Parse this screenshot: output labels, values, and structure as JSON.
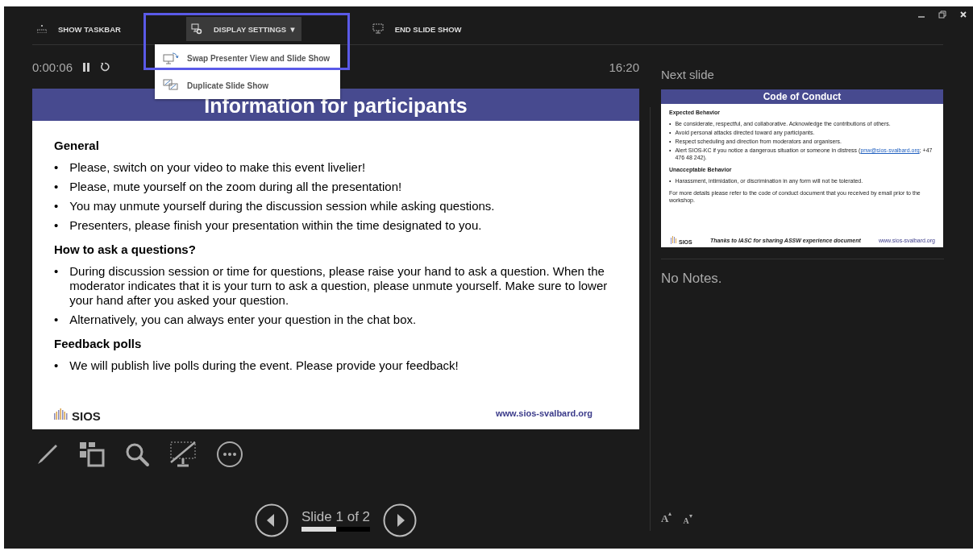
{
  "toolbar": {
    "items": [
      {
        "kind": "taskbar",
        "label": "SHOW TASKBAR",
        "expanded": false
      },
      {
        "kind": "display",
        "label": "DISPLAY SETTINGS",
        "caret": "▼",
        "expanded": true
      },
      {
        "kind": "end",
        "label": "END SLIDE SHOW",
        "expanded": false
      }
    ]
  },
  "menu": {
    "items": [
      {
        "kind": "swap",
        "label": "Swap Presenter View and Slide Show"
      },
      {
        "kind": "duplicate",
        "label": "Duplicate Slide Show"
      }
    ]
  },
  "timer": {
    "elapsed": "0:00:06",
    "clock": "16:20"
  },
  "slide": {
    "title": "Information for participants",
    "sections": [
      {
        "heading": "General",
        "bullets": [
          "Please, switch on your video to make this event livelier!",
          "Please, mute yourself on the zoom during all the presentation!",
          "You may unmute yourself during the discussion session while asking questions.",
          "Presenters, please finish your presentation within the time designated to you."
        ]
      },
      {
        "heading": "How to ask a questions?",
        "bullets": [
          "During discussion session or time for questions, please raise your hand to ask a question. When the moderator indicates that it is your turn to ask a question, please unmute yourself. Make sure to lower your hand after you asked your question.",
          "Alternatively, you can always enter your question in the chat box."
        ]
      },
      {
        "heading": "Feedback polls",
        "bullets": [
          "We will publish live polls during the event. Please provide your feedback!"
        ]
      }
    ],
    "bullet_mark": "•",
    "logo": "SIOS",
    "url": "www.sios-svalbard.org"
  },
  "next_slide": {
    "label": "Next slide",
    "title": "Code of Conduct",
    "sections": [
      {
        "heading": "Expected Behavior",
        "bullets": [
          {
            "text": "Be considerate, respectful, and collaborative. Acknowledge the contributions of others."
          },
          {
            "text": "Avoid personal attacks directed toward any participants."
          },
          {
            "text": "Respect scheduling and direction from moderators and organisers."
          },
          {
            "text": "Alert SIOS-KC if you notice a dangerous situation or someone in distress (",
            "link": "pnw@sios-svalbard.org",
            "after": ";  +47 476 48 242)."
          }
        ]
      },
      {
        "heading": "Unacceptable Behavior",
        "bullets": [
          {
            "text": "Harassment, intimidation, or discrimination in any form will not be tolerated."
          }
        ]
      }
    ],
    "bullet_mark": "•",
    "paragraph": "For more details please refer to the code of conduct document that you received by email prior to the workshop.",
    "logo": "SIOS",
    "credit": "Thanks to IASC for sharing ASSW experience document",
    "url": "www.sios-svalbard.org"
  },
  "notes": {
    "text": "No Notes.",
    "font_buttons": [
      {
        "kind": "increase",
        "label": "A"
      },
      {
        "kind": "decrease",
        "label": "A"
      }
    ]
  },
  "navigation": {
    "counter": "Slide 1 of 2",
    "level": 0.5
  }
}
